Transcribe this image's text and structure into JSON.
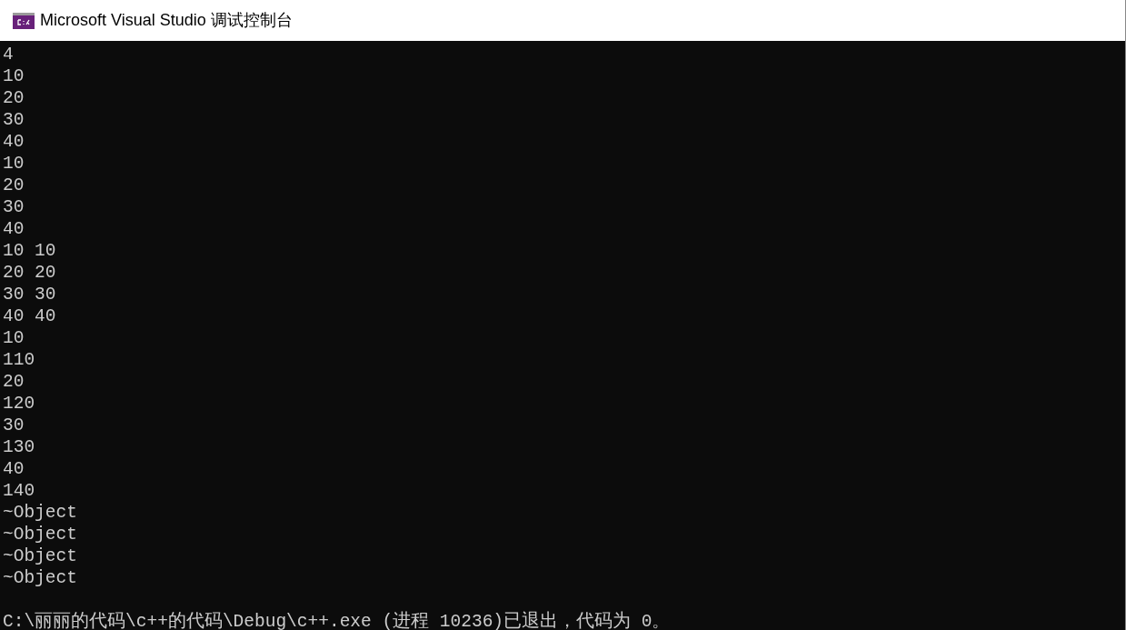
{
  "window": {
    "title": "Microsoft Visual Studio 调试控制台"
  },
  "console": {
    "lines": [
      "4",
      "10",
      "20",
      "30",
      "40",
      "10",
      "20",
      "30",
      "40",
      "10 10",
      "20 20",
      "30 30",
      "40 40",
      "10",
      "110",
      "20",
      "120",
      "30",
      "130",
      "40",
      "140",
      "~Object",
      "~Object",
      "~Object",
      "~Object"
    ],
    "exit_message": "C:\\丽丽的代码\\c++的代码\\Debug\\c++.exe (进程 10236)已退出，代码为 0。"
  }
}
